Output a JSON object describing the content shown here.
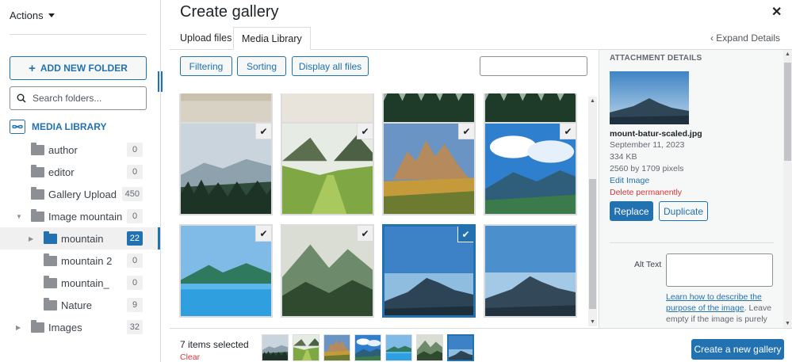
{
  "sidebar": {
    "actions_label": "Actions",
    "add_folder_label": "ADD NEW FOLDER",
    "search_placeholder": "Search folders...",
    "media_library_label": "MEDIA LIBRARY",
    "folders": [
      {
        "name": "author",
        "count": "0",
        "level": 0,
        "expandable": false,
        "active": false
      },
      {
        "name": "editor",
        "count": "0",
        "level": 0,
        "expandable": false,
        "active": false
      },
      {
        "name": "Gallery Upload",
        "count": "450",
        "level": 0,
        "expandable": false,
        "active": false
      },
      {
        "name": "Image mountain",
        "count": "0",
        "level": 0,
        "expandable": true,
        "expanded": true,
        "active": false
      },
      {
        "name": "mountain",
        "count": "22",
        "level": 1,
        "expandable": true,
        "active": true
      },
      {
        "name": "mountain 2",
        "count": "0",
        "level": 1,
        "expandable": false,
        "active": false
      },
      {
        "name": "mountain_",
        "count": "0",
        "level": 1,
        "expandable": false,
        "active": false
      },
      {
        "name": "Nature",
        "count": "9",
        "level": 1,
        "expandable": false,
        "active": false
      },
      {
        "name": "Images",
        "count": "32",
        "level": 0,
        "expandable": true,
        "active": false
      }
    ]
  },
  "modal": {
    "title": "Create gallery",
    "tabs": [
      "Upload files",
      "Media Library"
    ],
    "active_tab": "Media Library",
    "expand_details": "Expand Details",
    "toolbar": {
      "filtering": "Filtering",
      "sorting": "Sorting",
      "display_all": "Display all files",
      "search_placeholder": ""
    }
  },
  "grid": {
    "items": [
      {
        "scene": "beige",
        "selected": false
      },
      {
        "scene": "cloudy-beige",
        "selected": false
      },
      {
        "scene": "forest-dark",
        "selected": false
      },
      {
        "scene": "forest-dark",
        "selected": false
      },
      {
        "scene": "misty-valley",
        "selected": true
      },
      {
        "scene": "green-valley",
        "selected": true
      },
      {
        "scene": "dolomites",
        "selected": true
      },
      {
        "scene": "blue-sky-mountains",
        "selected": true
      },
      {
        "scene": "blue-lake",
        "selected": true
      },
      {
        "scene": "misty-green",
        "selected": true
      },
      {
        "scene": "mount-batur",
        "selected": true,
        "current": true
      },
      {
        "scene": "mount-batur-2",
        "selected": false
      }
    ]
  },
  "details": {
    "header": "ATTACHMENT DETAILS",
    "filename": "mount-batur-scaled.jpg",
    "date": "September 11, 2023",
    "size": "334 KB",
    "dimensions": "2560 by 1709 pixels",
    "edit_image": "Edit Image",
    "delete": "Delete permanently",
    "replace": "Replace",
    "duplicate": "Duplicate",
    "alt_text_label": "Alt Text",
    "alt_text_value": "",
    "alt_help_link": "Learn how to describe the purpose of the image",
    "alt_help_rest": ". Leave empty if the image is purely"
  },
  "bottom": {
    "selected_count": "7 items selected",
    "clear": "Clear",
    "create_button": "Create a new gallery"
  },
  "colors": {
    "accent": "#2271b1",
    "danger": "#d63638"
  }
}
